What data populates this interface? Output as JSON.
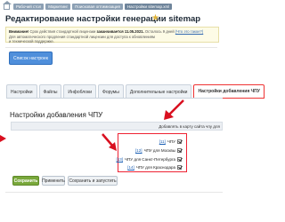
{
  "breadcrumb": [
    "Рабочий стол",
    "Маркетинг",
    "Поисковая оптимизация",
    "Настройки sitemap.xml"
  ],
  "page": {
    "title": "Редактирование настройки генерации sitemap"
  },
  "warning": {
    "line1_prefix": "Внимание!",
    "line1_text": " Срок действия стандартной лицензии",
    "line1_bold": " заканчивается 11.05.2021.",
    "line1_after": " Осталось 9 дней",
    "line1_link": "(Что это такое?)",
    "line2": "Для автоматического продления стандартной лицензии для доступа к обновлениям",
    "line3": "и технической поддержке."
  },
  "back_button": {
    "label": "Список настроек"
  },
  "tabs": [
    {
      "label": "Настройки",
      "active": false
    },
    {
      "label": "Файлы",
      "active": false
    },
    {
      "label": "Инфоблоки",
      "active": false
    },
    {
      "label": "Форумы",
      "active": false
    },
    {
      "label": "Дополнительные настройки",
      "active": false
    },
    {
      "label": "Настройки добавления ЧПУ",
      "active": true
    }
  ],
  "section": {
    "title": "Настройки добавления ЧПУ",
    "column_header": "Добавлять в карту сайта чпу для"
  },
  "rows": [
    {
      "id": "[11]",
      "name": "ЧПУ"
    },
    {
      "id": "[12]",
      "name": "ЧПУ для Москвы"
    },
    {
      "id": "[13]",
      "name": "ЧПУ для Санкт-Петербурга"
    },
    {
      "id": "[14]",
      "name": "ЧПУ для Краснодара"
    }
  ],
  "actions": {
    "save": "Сохранить",
    "apply": "Применить",
    "save_run": "Сохранить и запустить"
  }
}
